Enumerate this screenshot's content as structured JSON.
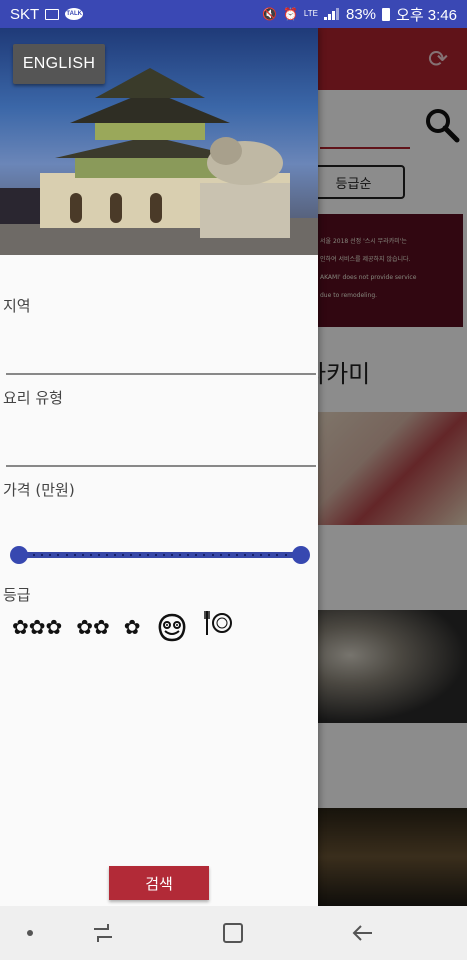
{
  "status_bar": {
    "carrier": "SKT",
    "network": "LTE",
    "battery": "83%",
    "time": "오후 3:46",
    "icons": [
      "picture-icon",
      "talk-icon",
      "mute-icon",
      "alarm-icon",
      "signal-icon",
      "battery-icon"
    ]
  },
  "background_screen": {
    "sort_button": "등급순",
    "notice_lines": [
      "서울 2018 선정 '스시 무라카미'는",
      "인하여 서비스를 제공하지 않습니다.",
      "AKAMI' does not provide service",
      "due to remodeling."
    ],
    "restaurant_title_fragment": "라카미"
  },
  "drawer": {
    "language_button": "ENGLISH",
    "region_label": "지역",
    "region_value": "",
    "cuisine_label": "요리 유형",
    "cuisine_value": "",
    "price_label": "가격 (만원)",
    "price_range": {
      "min": 0,
      "max": 1
    },
    "grade_label": "등급",
    "grade_options": [
      {
        "name": "three-star",
        "glyph": "✿✿✿"
      },
      {
        "name": "two-star",
        "glyph": "✿✿"
      },
      {
        "name": "one-star",
        "glyph": "✿"
      },
      {
        "name": "bib-gourmand",
        "glyph": ""
      },
      {
        "name": "plate",
        "glyph": "🍽"
      }
    ],
    "search_button": "검색"
  },
  "colors": {
    "status_bar": "#3a48b4",
    "brand_red": "#b0232f",
    "slider": "#3748a8",
    "language_button": "#555555"
  }
}
